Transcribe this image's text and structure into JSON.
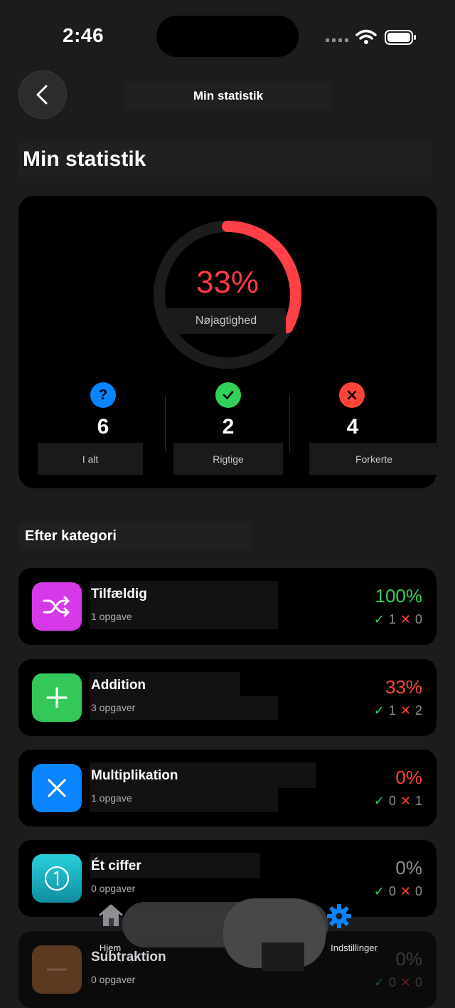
{
  "status": {
    "time": "2:46"
  },
  "nav": {
    "title": "Min statistik"
  },
  "page": {
    "title": "Min statistik"
  },
  "summary": {
    "accuracy_text": "33%",
    "accuracy_fraction": 0.33,
    "accuracy_label": "Nøjagtighed",
    "stats": [
      {
        "icon": "question-icon",
        "value": "6",
        "label": "I alt",
        "color": "#0a84ff"
      },
      {
        "icon": "check-icon",
        "value": "2",
        "label": "Rigtige",
        "color": "#30d158"
      },
      {
        "icon": "x-icon",
        "value": "4",
        "label": "Forkerte",
        "color": "#ff453a"
      }
    ]
  },
  "section": {
    "title": "Efter kategori"
  },
  "categories": [
    {
      "name": "Tilfældig",
      "sub": "1 opgave",
      "pct": "100%",
      "correct": "1",
      "wrong": "0",
      "icon": "shuffle-icon",
      "color": "#d63ae8",
      "pct_color": "#30d158"
    },
    {
      "name": "Addition",
      "sub": "3 opgaver",
      "pct": "33%",
      "correct": "1",
      "wrong": "2",
      "icon": "plus-icon",
      "color": "#34c759",
      "pct_color": "#ff453a"
    },
    {
      "name": "Multiplikation",
      "sub": "1 opgave",
      "pct": "0%",
      "correct": "0",
      "wrong": "1",
      "icon": "times-icon",
      "color": "#0a84ff",
      "pct_color": "#ff453a"
    },
    {
      "name": "Ét ciffer",
      "sub": "0 opgaver",
      "pct": "0%",
      "correct": "0",
      "wrong": "0",
      "icon": "digit-one-icon",
      "color": "#1fb5c9",
      "pct_color": "#8e8e93"
    },
    {
      "name": "Subtraktion",
      "sub": "0 opgaver",
      "pct": "0%",
      "correct": "0",
      "wrong": "0",
      "icon": "minus-icon",
      "color": "#7a4a2a",
      "pct_color": "#8e8e93"
    }
  ],
  "tabbar": {
    "home_label": "Hjem",
    "settings_label": "Indstillinger"
  }
}
